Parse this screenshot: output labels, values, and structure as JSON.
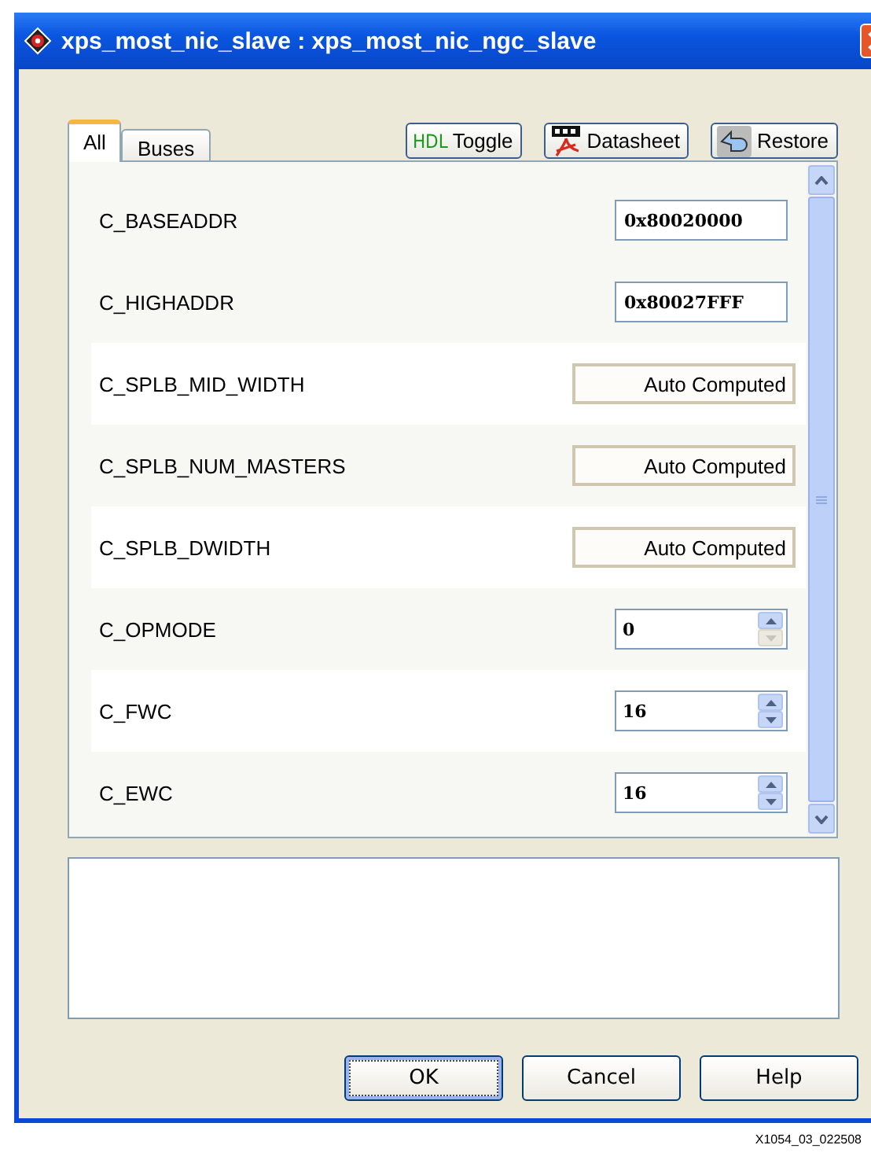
{
  "window": {
    "title": "xps_most_nic_slave : xps_most_nic_ngc_slave"
  },
  "tabs": [
    {
      "label": "All",
      "selected": true
    },
    {
      "label": "Buses",
      "selected": false
    }
  ],
  "toolbar": [
    {
      "kind": "hdl",
      "prefix": "HDL",
      "label": "Toggle"
    },
    {
      "kind": "pdf",
      "label": "Datasheet"
    },
    {
      "kind": "restore",
      "label": "Restore"
    }
  ],
  "parameters": [
    {
      "name": "C_BASEADDR",
      "kind": "text",
      "value": "0x80020000"
    },
    {
      "name": "C_HIGHADDR",
      "kind": "text",
      "value": "0x80027FFF"
    },
    {
      "name": "C_SPLB_MID_WIDTH",
      "kind": "auto",
      "value": "Auto Computed"
    },
    {
      "name": "C_SPLB_NUM_MASTERS",
      "kind": "auto",
      "value": "Auto Computed"
    },
    {
      "name": "C_SPLB_DWIDTH",
      "kind": "auto",
      "value": "Auto Computed"
    },
    {
      "name": "C_OPMODE",
      "kind": "spin",
      "value": "0",
      "down_disabled": true
    },
    {
      "name": "C_FWC",
      "kind": "spin",
      "value": "16",
      "down_disabled": false
    },
    {
      "name": "C_EWC",
      "kind": "spin",
      "value": "16",
      "down_disabled": false
    }
  ],
  "buttons": [
    {
      "label": "OK",
      "default": true
    },
    {
      "label": "Cancel",
      "default": false
    },
    {
      "label": "Help",
      "default": false
    }
  ],
  "figure_label": "X1054_03_022508"
}
